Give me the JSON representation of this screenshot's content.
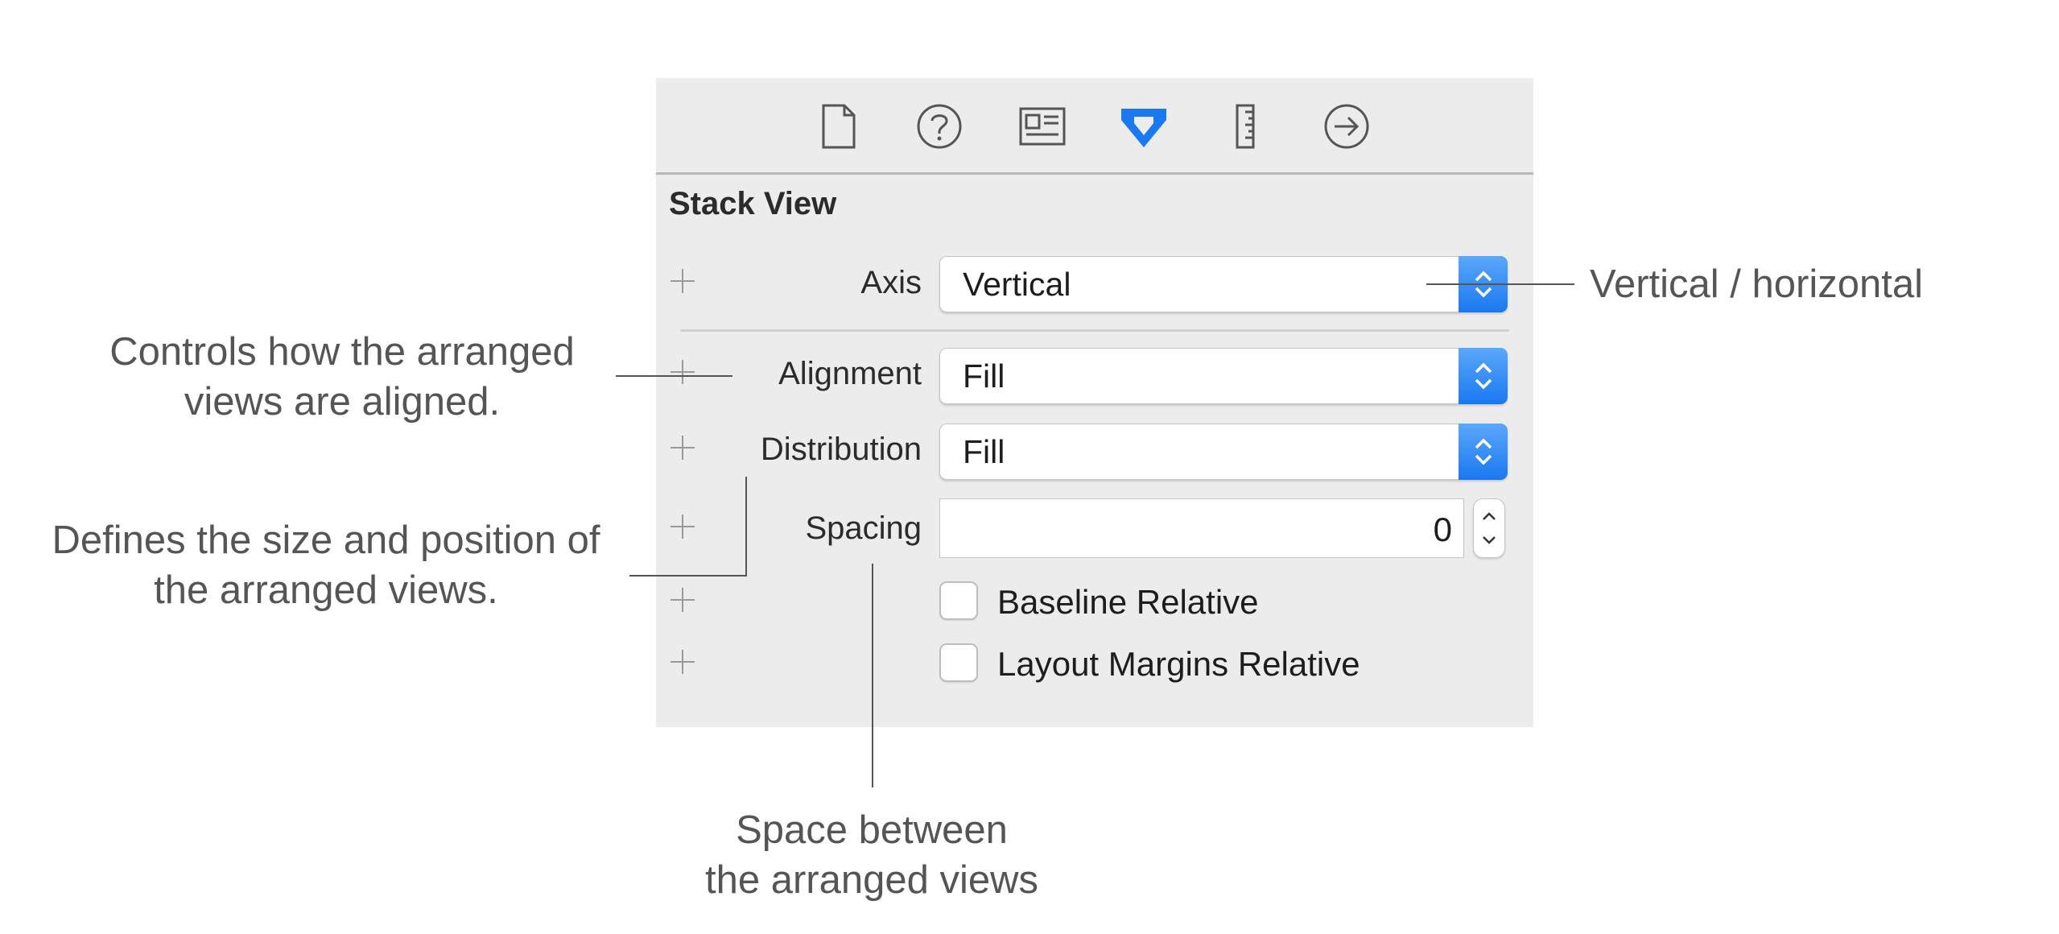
{
  "toolbar": {
    "icons": [
      "file-icon",
      "help-icon",
      "identity-icon",
      "attributes-icon",
      "ruler-icon",
      "connections-icon"
    ],
    "selected_icon": "attributes-icon",
    "accent_color": "#1a78f0"
  },
  "inspector": {
    "section_title": "Stack View",
    "axis": {
      "label": "Axis",
      "value": "Vertical"
    },
    "alignment": {
      "label": "Alignment",
      "value": "Fill"
    },
    "distribution": {
      "label": "Distribution",
      "value": "Fill"
    },
    "spacing": {
      "label": "Spacing",
      "value": "0"
    },
    "baseline_relative": {
      "label": "Baseline Relative",
      "checked": false
    },
    "layout_margins_relative": {
      "label": "Layout Margins Relative",
      "checked": false
    }
  },
  "annotations": {
    "axis_note": "Vertical / horizontal",
    "alignment_note_line1": "Controls how the arranged",
    "alignment_note_line2": "views are aligned.",
    "distribution_note_line1": "Defines the size and position of",
    "distribution_note_line2": "the arranged views.",
    "spacing_note_line1": "Space between",
    "spacing_note_line2": "the arranged views"
  }
}
